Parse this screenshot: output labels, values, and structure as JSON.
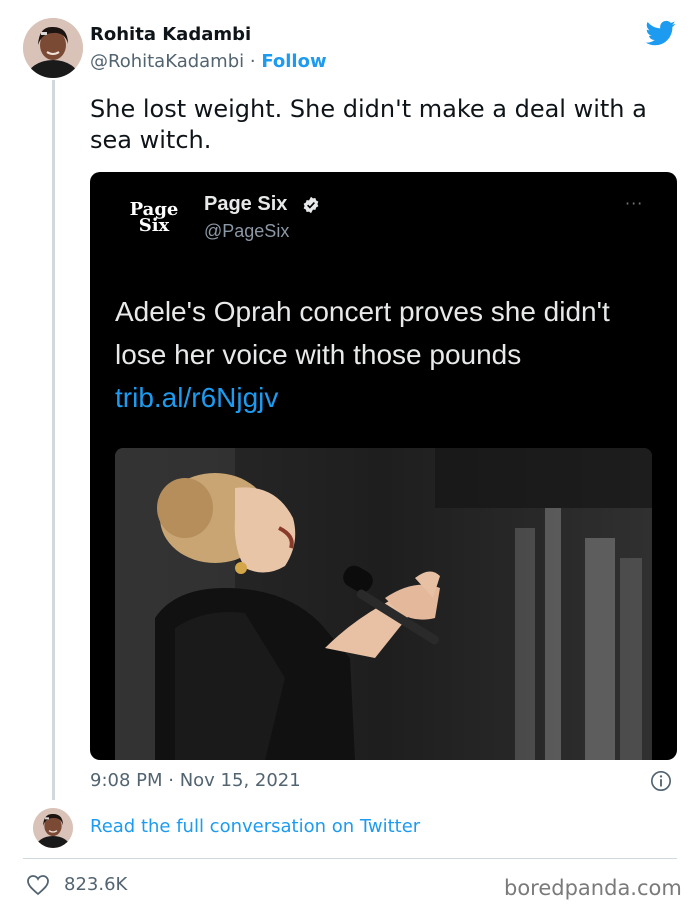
{
  "author": {
    "name": "Rohita Kadambi",
    "handle": "@RohitaKadambi",
    "separator": " · ",
    "follow_label": "Follow"
  },
  "tweet": {
    "text": "She lost weight. She didn't make a deal with a sea witch.",
    "timestamp": "9:08 PM · Nov 15, 2021"
  },
  "quoted_screenshot": {
    "logo_line1": "Page",
    "logo_line2": "Six",
    "name": "Page Six",
    "handle": "@PageSix",
    "more": "···",
    "text": "Adele's Oprah concert proves she didn't lose her voice with those pounds ",
    "link": "trib.al/r6Njgjv"
  },
  "footer": {
    "read_more": "Read the full conversation on Twitter",
    "likes": "823.6K"
  },
  "watermark": "boredpanda.com",
  "icons": {
    "brand": "twitter-bird-icon",
    "verified": "verified-badge-icon",
    "info": "info-icon",
    "like": "heart-icon"
  },
  "colors": {
    "accent": "#1d9bf0",
    "text_primary": "#0f1419",
    "text_secondary": "#536471",
    "card_bg": "#000000"
  }
}
